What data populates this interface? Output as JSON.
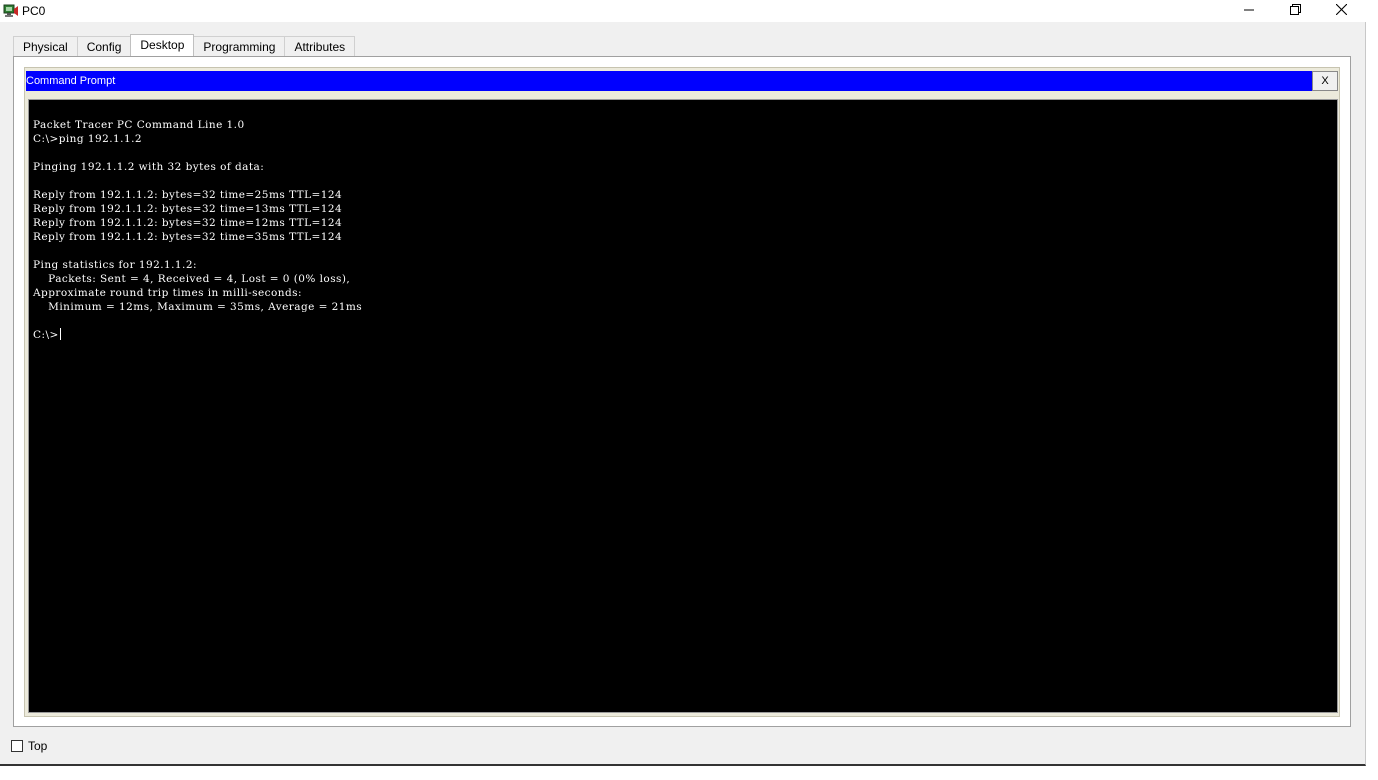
{
  "window": {
    "title": "PC0",
    "icon": "packet-tracer-pc-icon",
    "controls": {
      "minimize_icon": "minimize-icon",
      "restore_icon": "restore-icon",
      "close_icon": "close-icon"
    }
  },
  "tabs": [
    {
      "label": "Physical",
      "active": false
    },
    {
      "label": "Config",
      "active": false
    },
    {
      "label": "Desktop",
      "active": true
    },
    {
      "label": "Programming",
      "active": false
    },
    {
      "label": "Attributes",
      "active": false
    }
  ],
  "command_prompt": {
    "title": "Command Prompt",
    "close_label": "X",
    "title_bar_color": "#0000ff",
    "console_background": "#000000",
    "console_text_color": "#ffffff",
    "lines": [
      "Packet Tracer PC Command Line 1.0",
      "C:\\>ping 192.1.1.2",
      "",
      "Pinging 192.1.1.2 with 32 bytes of data:",
      "",
      "Reply from 192.1.1.2: bytes=32 time=25ms TTL=124",
      "Reply from 192.1.1.2: bytes=32 time=13ms TTL=124",
      "Reply from 192.1.1.2: bytes=32 time=12ms TTL=124",
      "Reply from 192.1.1.2: bytes=32 time=35ms TTL=124",
      "",
      "Ping statistics for 192.1.1.2:",
      "    Packets: Sent = 4, Received = 4, Lost = 0 (0% loss),",
      "Approximate round trip times in milli-seconds:",
      "    Minimum = 12ms, Maximum = 35ms, Average = 21ms",
      ""
    ],
    "prompt": "C:\\>"
  },
  "bottom": {
    "top_checkbox_label": "Top",
    "top_checked": false
  }
}
